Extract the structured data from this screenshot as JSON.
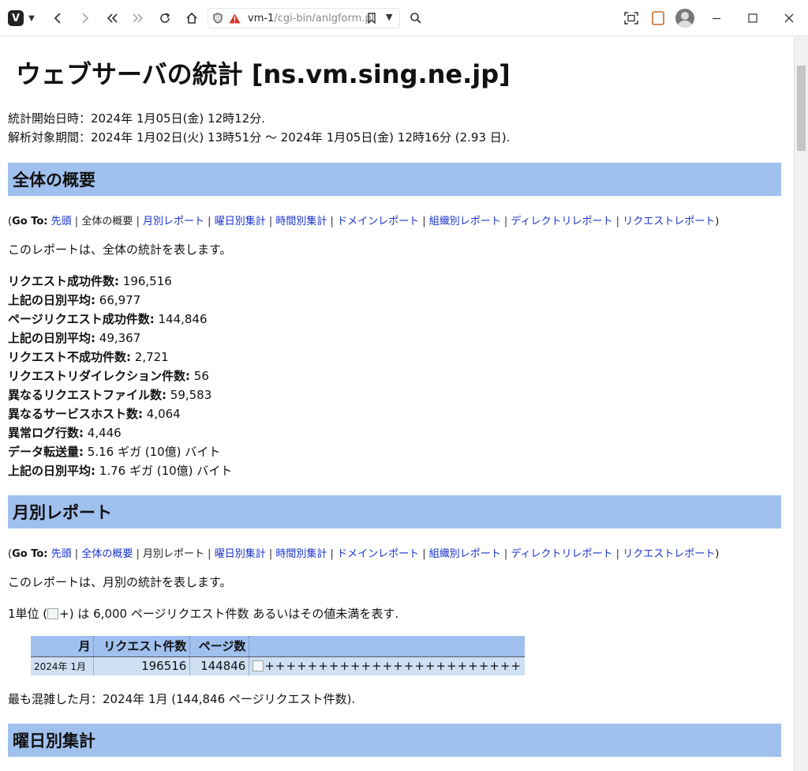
{
  "browser": {
    "url_host": "vm-1",
    "url_path": "/cgi-bin/anlgform.pl"
  },
  "page": {
    "title": "ウェブサーバの統計 [ns.vm.sing.ne.jp]",
    "start_line": "統計開始日時：2024年 1月05日(金) 12時12分.",
    "period_line": "解析対象期間：2024年 1月02日(火) 13時51分 〜 2024年 1月05日(金) 12時16分 (2.93 日)."
  },
  "goto": {
    "prefix": "(",
    "label": "Go To",
    "colon": ":",
    "suffix": ")",
    "links": [
      "先頭",
      "全体の概要",
      "月別レポート",
      "曜日別集計",
      "時間別集計",
      "ドメインレポート",
      "組織別レポート",
      "ディレクトリレポート",
      "リクエストレポート"
    ],
    "sep": "|"
  },
  "summary": {
    "header": "全体の概要",
    "description": "このレポートは、全体の統計を表します。",
    "stats": [
      {
        "label": "リクエスト成功件数:",
        "value": "196,516"
      },
      {
        "label": "上記の日別平均:",
        "value": "66,977"
      },
      {
        "label": "ページリクエスト成功件数:",
        "value": "144,846"
      },
      {
        "label": "上記の日別平均:",
        "value": "49,367"
      },
      {
        "label": "リクエスト不成功件数:",
        "value": "2,721"
      },
      {
        "label": "リクエストリダイレクション件数:",
        "value": "56"
      },
      {
        "label": "異なるリクエストファイル数:",
        "value": "59,583"
      },
      {
        "label": "異なるサービスホスト数:",
        "value": "4,064"
      },
      {
        "label": "異常ログ行数:",
        "value": "4,446"
      },
      {
        "label": "データ転送量:",
        "value": "5.16 ギガ (10億) バイト"
      },
      {
        "label": "上記の日別平均:",
        "value": "1.76 ギガ (10億) バイト"
      }
    ]
  },
  "monthly": {
    "header": "月別レポート",
    "description": "このレポートは、月別の統計を表します。",
    "unit_prefix": "1単位 (",
    "unit_symbol": "+",
    "unit_suffix": ") は 6,000 ページリクエスト件数 あるいはその値未満を表す.",
    "table": {
      "headers": [
        "月",
        "リクエスト件数",
        "ページ数",
        ""
      ],
      "rows": [
        {
          "month": "2024年 1月",
          "requests": "196516",
          "pages": "144846",
          "bar": "++++++++++++++++++++++++"
        }
      ]
    },
    "busiest": "最も混雑した月：2024年 1月 (144,846 ページリクエスト件数)."
  },
  "weekday": {
    "header": "曜日別集計"
  }
}
